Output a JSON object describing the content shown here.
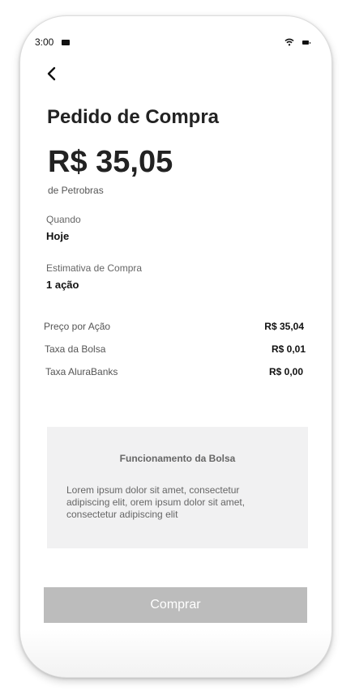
{
  "status_bar": {
    "time": "3:00",
    "icons": [
      "mail-icon",
      "wifi-icon",
      "battery-icon"
    ]
  },
  "header": {
    "back_icon": "chevron-left-icon"
  },
  "order": {
    "title": "Pedido de Compra",
    "amount": "R$ 35,05",
    "company": "de Petrobras",
    "when_label": "Quando",
    "when_value": "Hoje",
    "estimate_label": "Estimativa de Compra",
    "estimate_value": "1 ação"
  },
  "details": [
    {
      "label": "Preço por Ação",
      "value": "R$ 35,04"
    },
    {
      "label": "Taxa da Bolsa",
      "value": "R$ 0,01"
    },
    {
      "label": "Taxa AluraBanks",
      "value": "R$ 0,00"
    }
  ],
  "info": {
    "title": "Funcionamento da Bolsa",
    "text": "Lorem ipsum dolor sit amet, consectetur adipiscing elit, orem ipsum dolor sit amet, consectetur adipiscing elit"
  },
  "actions": {
    "buy_label": "Comprar"
  },
  "colors": {
    "button_bg": "#bcbcbc",
    "info_bg": "#f1f1f2",
    "text_primary": "#222222"
  }
}
